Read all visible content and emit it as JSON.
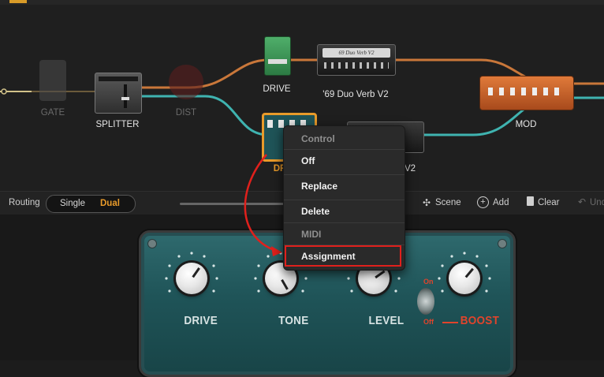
{
  "chain": {
    "blocks": [
      {
        "label": "GATE",
        "state": "bypassed"
      },
      {
        "label": "SPLITTER",
        "state": "active"
      },
      {
        "label": "DIST",
        "state": "bypassed"
      },
      {
        "label": "DRIVE",
        "state": "active"
      },
      {
        "label": "'69 Duo Verb V2",
        "state": "active"
      },
      {
        "label": "DR",
        "state": "selected"
      },
      {
        "label": "V2",
        "state": "active"
      },
      {
        "label": "MOD",
        "state": "active"
      }
    ],
    "amp_plate_text": "69 Duo Verb V2"
  },
  "toolbar": {
    "routing_label": "Routing",
    "single_label": "Single",
    "dual_label": "Dual",
    "scene_label": "Scene",
    "add_label": "Add",
    "clear_label": "Clear",
    "undo_label": "Und"
  },
  "context_menu": {
    "header_control": "Control",
    "off": "Off",
    "replace": "Replace",
    "delete": "Delete",
    "header_midi": "MIDI",
    "assignment": "Assignment"
  },
  "pedal": {
    "knobs": [
      "DRIVE",
      "TONE",
      "LEVEL",
      "BOOST"
    ],
    "switch_on": "On",
    "switch_off": "Off"
  },
  "colors": {
    "accent_orange": "#e89a2a",
    "cable_orange": "#c9773a",
    "cable_teal": "#3fb3b0",
    "highlight_red": "#e0201c",
    "pedal_teal": "#1f5458"
  }
}
